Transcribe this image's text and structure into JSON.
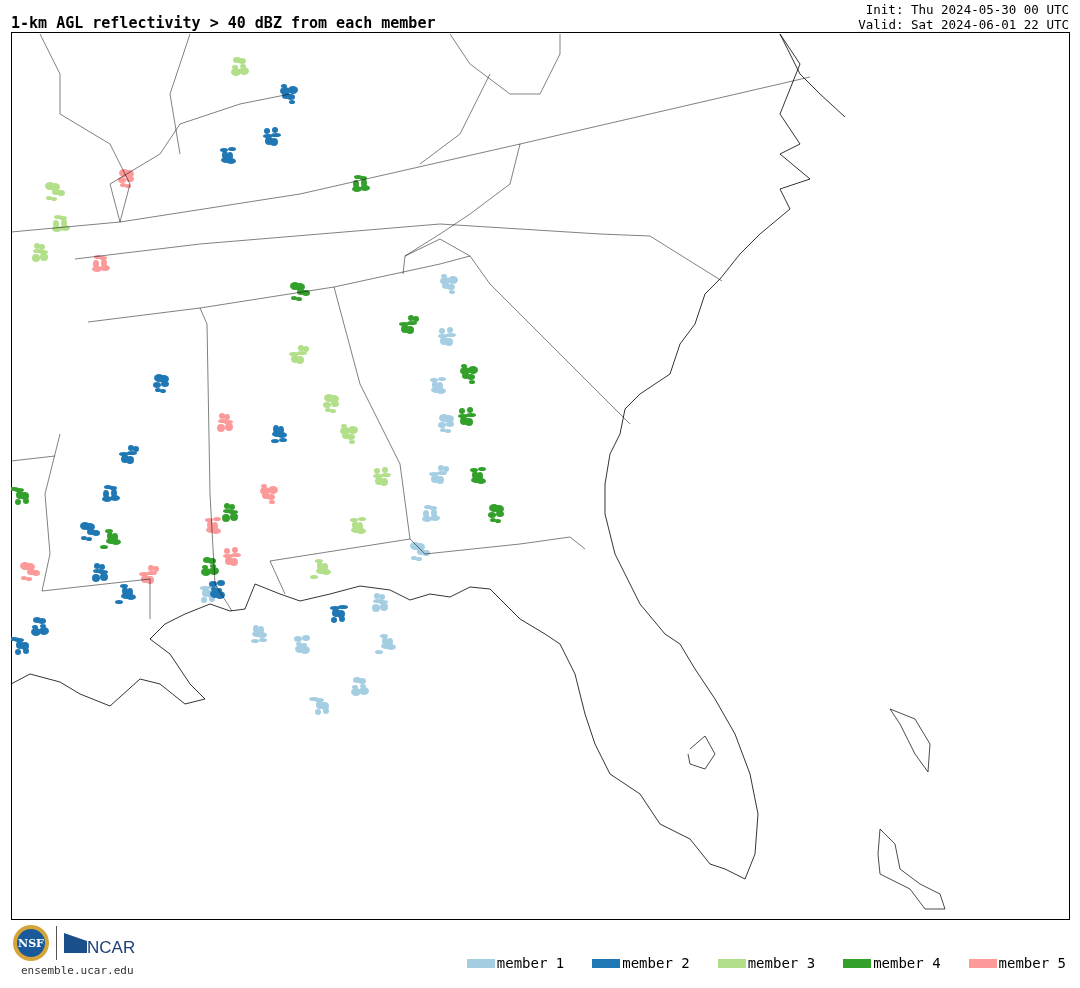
{
  "title": "1-km AGL reflectivity > 40 dBZ from each member",
  "init": "Init: Thu 2024-05-30 00 UTC",
  "valid": "Valid: Sat 2024-06-01 22 UTC",
  "logos": {
    "nsf": "NSF",
    "ncar": "NCAR"
  },
  "site": "ensemble.ucar.edu",
  "legend": [
    {
      "label": "member 1",
      "color": "#a6cee3"
    },
    {
      "label": "member 2",
      "color": "#1f78b4"
    },
    {
      "label": "member 3",
      "color": "#b2df8a"
    },
    {
      "label": "member 4",
      "color": "#33a02c"
    },
    {
      "label": "member 5",
      "color": "#fb9a99"
    }
  ]
}
